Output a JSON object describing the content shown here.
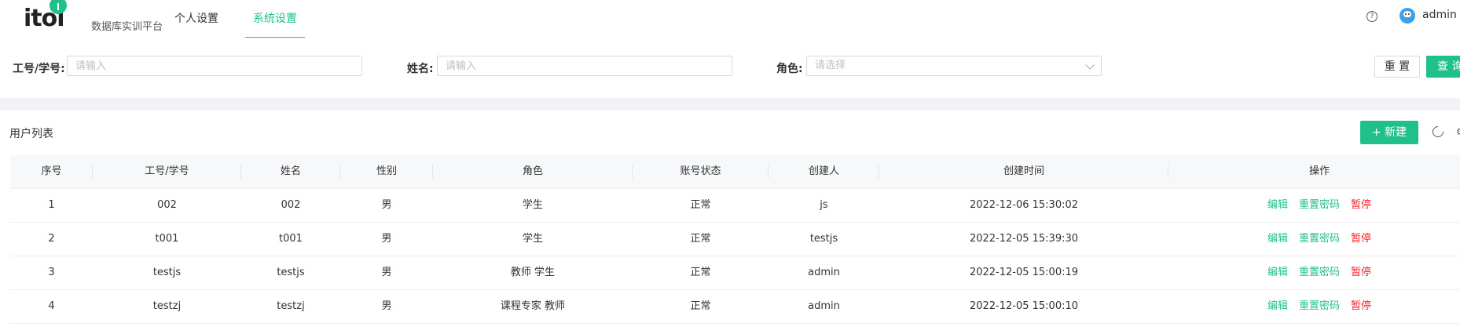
{
  "header": {
    "logo_text": "itol",
    "logo_subtitle": "数据库实训平台",
    "tabs": [
      {
        "label": "个人设置",
        "active": false
      },
      {
        "label": "系统设置",
        "active": true
      }
    ],
    "help_icon": "question-circle-icon",
    "user_name": "admin"
  },
  "filters": {
    "id_label": "工号/学号:",
    "id_placeholder": "请输入",
    "name_label": "姓名:",
    "name_placeholder": "请输入",
    "role_label": "角色:",
    "role_placeholder": "请选择",
    "reset_label": "重 置",
    "query_label": "查 询"
  },
  "list": {
    "title": "用户列表",
    "new_label": "+ 新建",
    "columns": [
      "序号",
      "工号/学号",
      "姓名",
      "性别",
      "角色",
      "账号状态",
      "创建人",
      "创建时间",
      "操作"
    ],
    "rows": [
      {
        "index": "1",
        "id": "002",
        "name": "002",
        "gender": "男",
        "role": "学生",
        "status": "正常",
        "creator": "js",
        "created_at": "2022-12-06 15:30:02"
      },
      {
        "index": "2",
        "id": "t001",
        "name": "t001",
        "gender": "男",
        "role": "学生",
        "status": "正常",
        "creator": "testjs",
        "created_at": "2022-12-05 15:39:30"
      },
      {
        "index": "3",
        "id": "testjs",
        "name": "testjs",
        "gender": "男",
        "role": "教师 学生",
        "status": "正常",
        "creator": "admin",
        "created_at": "2022-12-05 15:00:19"
      },
      {
        "index": "4",
        "id": "testzj",
        "name": "testzj",
        "gender": "男",
        "role": "课程专家 教师",
        "status": "正常",
        "creator": "admin",
        "created_at": "2022-12-05 15:00:10"
      }
    ],
    "actions": {
      "edit": "编辑",
      "reset_password": "重置密码",
      "suspend": "暂停"
    }
  },
  "colors": {
    "accent": "#20c08a",
    "danger": "#f5222d"
  }
}
